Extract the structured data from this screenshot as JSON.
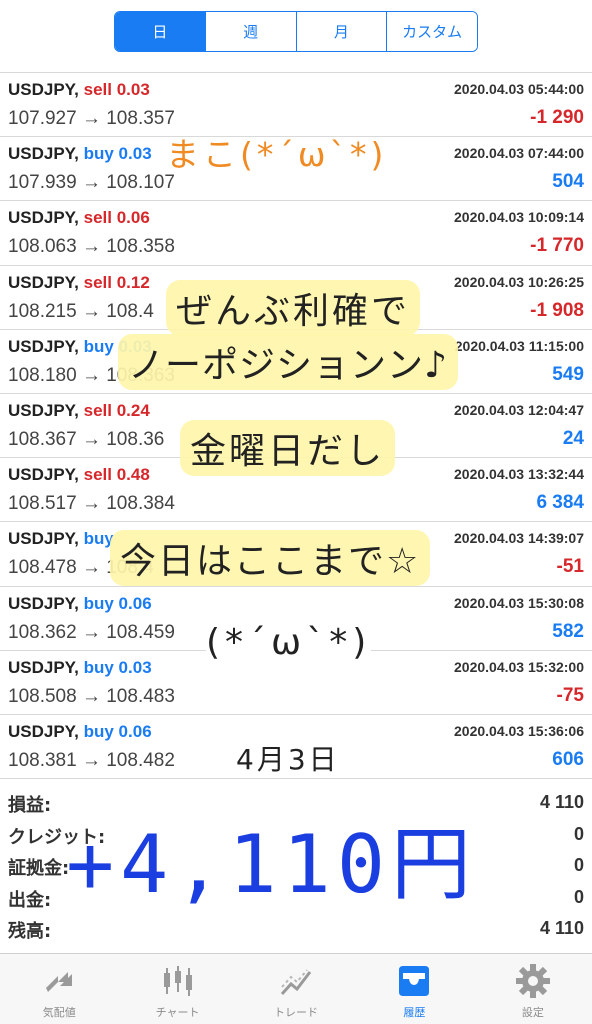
{
  "period_tabs": [
    {
      "label": "日",
      "active": true
    },
    {
      "label": "週",
      "active": false
    },
    {
      "label": "月",
      "active": false
    },
    {
      "label": "カスタム",
      "active": false
    }
  ],
  "trades": [
    {
      "symbol": "USDJPY,",
      "side": "sell",
      "volume": "sell 0.03",
      "price": "107.927 → 108.357",
      "time": "2020.04.03 05:44:00",
      "profit": "-1 290"
    },
    {
      "symbol": "USDJPY,",
      "side": "buy",
      "volume": "buy 0.03",
      "price": "107.939 → 108.107",
      "time": "2020.04.03 07:44:00",
      "profit": "504"
    },
    {
      "symbol": "USDJPY,",
      "side": "sell",
      "volume": "sell 0.06",
      "price": "108.063 → 108.358",
      "time": "2020.04.03 10:09:14",
      "profit": "-1 770"
    },
    {
      "symbol": "USDJPY,",
      "side": "sell",
      "volume": "sell 0.12",
      "price": "108.215 → 108.4",
      "time": "2020.04.03 10:26:25",
      "profit": "-1 908"
    },
    {
      "symbol": "USDJPY,",
      "side": "buy",
      "volume": "buy 0.03",
      "price": "108.180 → 108.363",
      "time": "2020.04.03 11:15:00",
      "profit": "549"
    },
    {
      "symbol": "USDJPY,",
      "side": "sell",
      "volume": "sell 0.24",
      "price": "108.367 → 108.36",
      "time": "2020.04.03 12:04:47",
      "profit": "24"
    },
    {
      "symbol": "USDJPY,",
      "side": "sell",
      "volume": "sell 0.48",
      "price": "108.517 → 108.384",
      "time": "2020.04.03 13:32:44",
      "profit": "6 384"
    },
    {
      "symbol": "USDJPY,",
      "side": "buy",
      "volume": "buy",
      "price": "108.478 → 108.4",
      "time": "2020.04.03 14:39:07",
      "profit": "-51"
    },
    {
      "symbol": "USDJPY,",
      "side": "buy",
      "volume": "buy 0.06",
      "price": "108.362 → 108.459",
      "time": "2020.04.03 15:30:08",
      "profit": "582"
    },
    {
      "symbol": "USDJPY,",
      "side": "buy",
      "volume": "buy 0.03",
      "price": "108.508 → 108.483",
      "time": "2020.04.03 15:32:00",
      "profit": "-75"
    },
    {
      "symbol": "USDJPY,",
      "side": "buy",
      "volume": "buy 0.06",
      "price": "108.381 → 108.482",
      "time": "2020.04.03 15:36:06",
      "profit": "606"
    }
  ],
  "summary": [
    {
      "label": "損益:",
      "value": "4 110"
    },
    {
      "label": "クレジット:",
      "value": "0"
    },
    {
      "label": "証拠金:",
      "value": "0"
    },
    {
      "label": "出金:",
      "value": "0"
    },
    {
      "label": "残高:",
      "value": "4 110"
    }
  ],
  "tabs": [
    {
      "label": "気配値",
      "icon": "quotes-arrow-icon",
      "active": false
    },
    {
      "label": "チャート",
      "icon": "candlestick-chart-icon",
      "active": false
    },
    {
      "label": "トレード",
      "icon": "trade-line-icon",
      "active": false
    },
    {
      "label": "履歴",
      "icon": "history-tray-icon",
      "active": true
    },
    {
      "label": "設定",
      "icon": "gear-icon",
      "active": false
    }
  ],
  "handwritten_notes": {
    "line_orange": "まこ(*´ω`*)",
    "line1": "ぜんぶ利確で",
    "line2": "ノーポジションン♪",
    "line3": "金曜日だし",
    "line4": "今日はここまで☆",
    "line5": "(*´ω`*)",
    "date": "4月3日",
    "total": "+4,110円"
  },
  "colors": {
    "accent": "#1a7cf2",
    "sell": "#d6272b",
    "buy": "#1a7cf2",
    "handwriting_big": "#1b3ee0",
    "handwriting_orange": "#f08a22",
    "highlight": "#fff6aa"
  }
}
